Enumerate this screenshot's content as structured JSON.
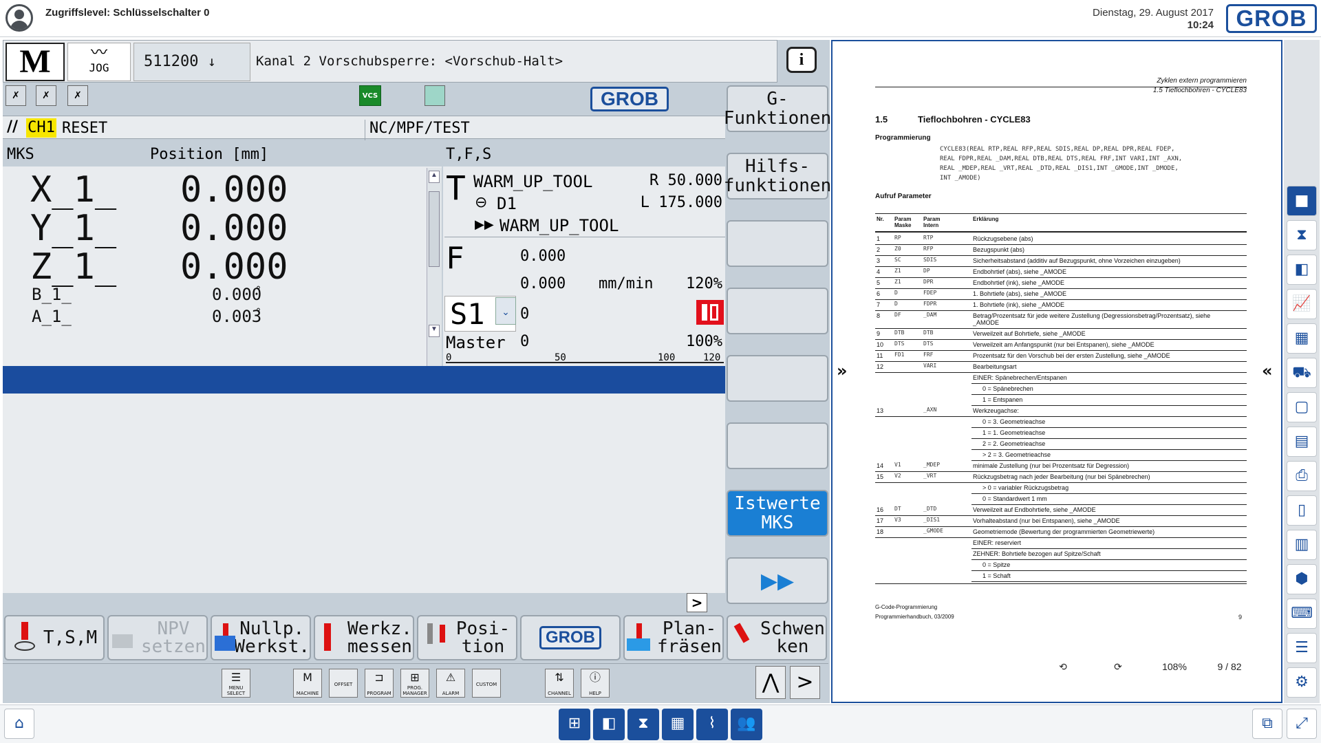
{
  "topbar": {
    "access_level": "Zugriffslevel: Schlüsselschalter 0",
    "date": "Dienstag, 29. August 2017",
    "time": "10:24",
    "brand": "GROB"
  },
  "header": {
    "mode": "M",
    "jog": "JOG",
    "program_number": "511200",
    "alarm_message": "Kanal 2 Vorschubsperre: <Vorschub-Halt>",
    "info": "i"
  },
  "status": {
    "vcs": "VCS",
    "brand": "GROB",
    "channel": "CH1",
    "channel_state": "RESET",
    "program_path": "NC/MPF/TEST"
  },
  "mks": {
    "title": "MKS",
    "position_header": "Position [mm]",
    "axes": [
      {
        "name": "X_1_",
        "value": "0.000"
      },
      {
        "name": "Y_1_",
        "value": "0.000"
      },
      {
        "name": "Z_1_",
        "value": "0.000"
      },
      {
        "name": "B_1_",
        "value": "0.000",
        "unit": "°"
      },
      {
        "name": "A_1_",
        "value": "0.003",
        "unit": "°"
      }
    ]
  },
  "tfs": {
    "title": "T,F,S",
    "tool_letter": "T",
    "tool_name": "WARM_UP_TOOL",
    "tool_radius": "R 50.000",
    "tool_edge": "D1",
    "tool_length": "L 175.000",
    "next_tool": "WARM_UP_TOOL",
    "feed_letter": "F",
    "feed_value": "0.000",
    "feed_actual": "0.000",
    "feed_unit": "mm/min",
    "feed_override": "120%",
    "spindle": "S1",
    "spindle_value": "0",
    "master_label": "Master",
    "master_value": "0",
    "master_override": "100%",
    "scale_ticks": [
      "0",
      "50",
      "100",
      "120"
    ]
  },
  "vertical_softkeys": [
    "G-\nFunktionen",
    "Hilfs-\nfunktionen",
    "",
    "",
    "",
    "",
    "Istwerte\nMKS",
    "▶▶"
  ],
  "horizontal_softkeys": [
    {
      "label": "T,S,M"
    },
    {
      "label": "NPV\nsetzen",
      "disabled": true
    },
    {
      "label": "Nullp.\nWerkst."
    },
    {
      "label": "Werkz.\nmessen"
    },
    {
      "label": "Posi-\ntion"
    },
    {
      "label": "GROB"
    },
    {
      "label": "Plan-\nfräsen"
    },
    {
      "label": "Schwen\nken"
    }
  ],
  "keys": [
    {
      "glyph": "☰",
      "label": "MENU\nSELECT"
    },
    {
      "glyph": "M",
      "label": "MACHINE"
    },
    {
      "glyph": "",
      "label": "OFFSET"
    },
    {
      "glyph": "⊐",
      "label": "PROGRAM"
    },
    {
      "glyph": "⊞",
      "label": "PROG.\nMANAGER"
    },
    {
      "glyph": "⚠",
      "label": "ALARM"
    },
    {
      "glyph": "",
      "label": "CUSTOM"
    },
    {
      "glyph": "⇅",
      "label": "CHANNEL"
    },
    {
      "glyph": "ⓘ",
      "label": "HELP"
    }
  ],
  "nav_arrow": ">",
  "pdf": {
    "running_head_1": "Zyklen extern programmieren",
    "running_head_2": "1.5 Tieflochbohren - CYCLE83",
    "section": "1.5",
    "section_title": "Tieflochbohren - CYCLE83",
    "sub_programming": "Programmierung",
    "code_lines": [
      "CYCLE83(REAL RTP,REAL RFP,REAL SDIS,REAL DP,REAL DPR,REAL FDEP,",
      "REAL FDPR,REAL _DAM,REAL DTB,REAL DTS,REAL FRF,INT VARI,INT _AXN,",
      "REAL _MDEP,REAL _VRT,REAL _DTD,REAL _DIS1,INT _GMODE,INT _DMODE,",
      "INT _AMODE)"
    ],
    "sub_params": "Aufruf Parameter",
    "col_nr": "Nr.",
    "col_mask": "Param Maske",
    "col_intern": "Param Intern",
    "col_expl": "Erklärung",
    "rows": [
      {
        "n": "1",
        "m": "RP",
        "i": "RTP",
        "e": "Rückzugsebene (abs)"
      },
      {
        "n": "2",
        "m": "Z0",
        "i": "RFP",
        "e": "Bezugspunkt (abs)"
      },
      {
        "n": "3",
        "m": "SC",
        "i": "SDIS",
        "e": "Sicherheitsabstand (additiv auf Bezugspunkt, ohne Vorzeichen einzugeben)"
      },
      {
        "n": "4",
        "m": "Z1",
        "i": "DP",
        "e": "Endbohrtief (abs), siehe _AMODE"
      },
      {
        "n": "5",
        "m": "Z1",
        "i": "DPR",
        "e": "Endbohrtief (ink), siehe _AMODE"
      },
      {
        "n": "6",
        "m": "D",
        "i": "FDEP",
        "e": "1. Bohrtiefe (abs), siehe _AMODE"
      },
      {
        "n": "7",
        "m": "D",
        "i": "FDPR",
        "e": "1. Bohrtiefe (ink), siehe _AMODE"
      },
      {
        "n": "8",
        "m": "DF",
        "i": "_DAM",
        "e": "Betrag/Prozentsatz für jede weitere Zustellung (Degressionsbetrag/Prozentsatz), siehe",
        "e2": "_AMODE"
      },
      {
        "n": "9",
        "m": "DTB",
        "i": "DTB",
        "e": "Verweilzeit auf Bohrtiefe, siehe _AMODE"
      },
      {
        "n": "10",
        "m": "DTS",
        "i": "DTS",
        "e": "Verweilzeit am Anfangspunkt (nur bei Entspanen), siehe _AMODE"
      },
      {
        "n": "11",
        "m": "FD1",
        "i": "FRF",
        "e": "Prozentsatz für den Vorschub bei der ersten Zustellung, siehe _AMODE"
      },
      {
        "n": "12",
        "m": "",
        "i": "VARI",
        "e": "Bearbeitungsart"
      },
      {
        "n": "",
        "m": "",
        "i": "",
        "e": "EINER: Spänebrechen/Entspanen"
      },
      {
        "n": "",
        "m": "",
        "i": "",
        "e": "0 = Spänebrechen"
      },
      {
        "n": "",
        "m": "",
        "i": "",
        "e": "1 = Entspanen"
      },
      {
        "n": "13",
        "m": "",
        "i": "_AXN",
        "e": "Werkzeugachse:"
      },
      {
        "n": "",
        "m": "",
        "i": "",
        "e": "0 = 3. Geometrieachse"
      },
      {
        "n": "",
        "m": "",
        "i": "",
        "e": "1 = 1. Geometrieachse"
      },
      {
        "n": "",
        "m": "",
        "i": "",
        "e": "2 = 2. Geometrieachse"
      },
      {
        "n": "",
        "m": "",
        "i": "",
        "e": "> 2 = 3. Geometrieachse"
      },
      {
        "n": "14",
        "m": "V1",
        "i": "_MDEP",
        "e": "minimale Zustellung (nur bei Prozentsatz für Degression)"
      },
      {
        "n": "15",
        "m": "V2",
        "i": "_VRT",
        "e": "Rückzugsbetrag nach jeder Bearbeitung (nur bei Spänebrechen)"
      },
      {
        "n": "",
        "m": "",
        "i": "",
        "e": "> 0 = variabler Rückzugsbetrag"
      },
      {
        "n": "",
        "m": "",
        "i": "",
        "e": "0 = Standardwert 1 mm"
      },
      {
        "n": "16",
        "m": "DT",
        "i": "_DTD",
        "e": "Verweilzeit auf Endbohrtiefe, siehe _AMODE"
      },
      {
        "n": "17",
        "m": "V3",
        "i": "_DIS1",
        "e": "Vorhalteabstand (nur bei Entspanen), siehe _AMODE"
      },
      {
        "n": "18",
        "m": "",
        "i": "_GMODE",
        "e": "Geometriemode (Bewertung der programmierten Geometriewerte)"
      },
      {
        "n": "",
        "m": "",
        "i": "",
        "e": "EINER: reserviert"
      },
      {
        "n": "",
        "m": "",
        "i": "",
        "e": "ZEHNER: Bohrtiefe bezogen auf Spitze/Schaft"
      },
      {
        "n": "",
        "m": "",
        "i": "",
        "e": "0 = Spitze"
      },
      {
        "n": "",
        "m": "",
        "i": "",
        "e": "1 = Schaft"
      }
    ],
    "footer_1": "G-Code-Programmierung",
    "footer_2": "Programmierhandbuch, 03/2009",
    "page_no": "9",
    "zoom": "108%",
    "page_counter": "9 / 82",
    "nav_left": "»",
    "nav_right": "«"
  },
  "right_sidebar_icons": [
    "camera-icon",
    "hourglass-icon",
    "cube-icon",
    "chart-icon",
    "calendar-icon",
    "cart-icon",
    "note-icon",
    "calculator-icon",
    "pdf-icon",
    "document-icon",
    "map-icon",
    "box-icon",
    "keyboard-icon",
    "list-icon",
    "gear-icon"
  ],
  "taskbar_icons": [
    "workpiece-icon",
    "cube-icon",
    "hourglass-icon",
    "calendar-icon",
    "chart-icon",
    "users-icon"
  ]
}
